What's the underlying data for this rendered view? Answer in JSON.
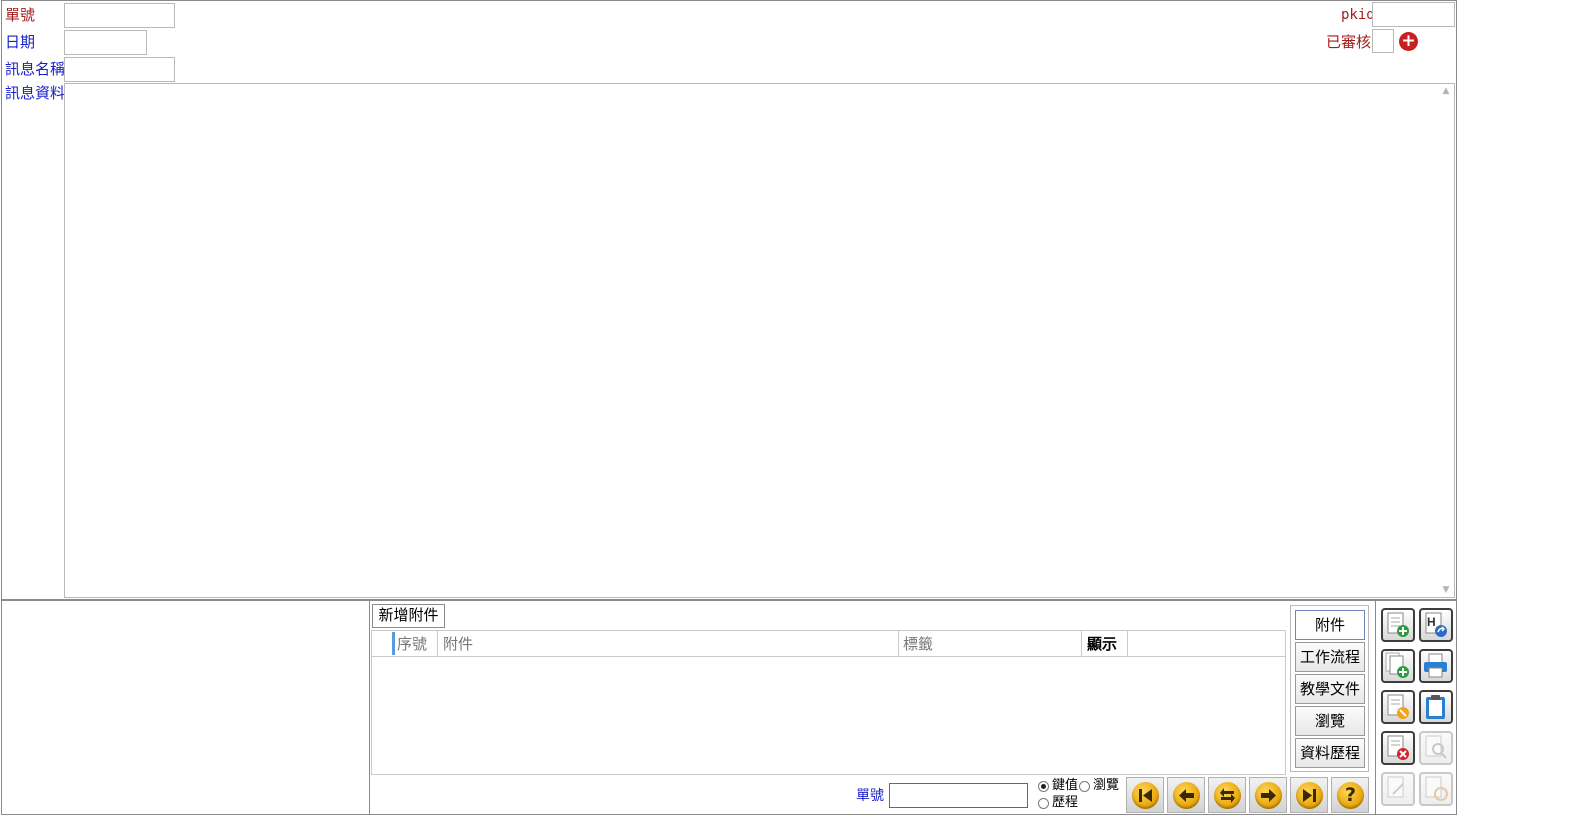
{
  "form": {
    "order_no_label": "單號",
    "date_label": "日期",
    "msg_name_label": "訊息名稱",
    "msg_data_label": "訊息資料",
    "pkid_label": "pkid",
    "reviewed_label": "已審核",
    "order_no_value": "",
    "date_value": "",
    "msg_name_value": "",
    "msg_data_value": "",
    "pkid_value": ""
  },
  "attachments": {
    "add_button": "新增附件",
    "columns": [
      "序號",
      "附件",
      "標籤",
      "顯示"
    ],
    "rows": []
  },
  "side_tabs": [
    "附件",
    "工作流程",
    "教學文件",
    "瀏覽",
    "資料歷程"
  ],
  "footer": {
    "search_label": "單號",
    "search_value": "",
    "radio_key": "鍵值",
    "radio_browse": "瀏覽",
    "radio_history": "歷程",
    "selected_radio": "鍵值"
  },
  "nav_icons": [
    "first-record-icon",
    "previous-record-icon",
    "refresh-icon",
    "next-record-icon",
    "last-record-icon",
    "help-icon"
  ],
  "toolbar_icons": [
    "add-record-icon",
    "html-export-icon",
    "copy-record-icon",
    "print-icon",
    "edit-record-icon",
    "clipboard-icon",
    "delete-record-icon",
    "search-disabled-icon",
    "save-disabled-icon",
    "cancel-disabled-icon"
  ],
  "colors": {
    "label_red": "#a51d1d",
    "label_blue": "#1a21c8",
    "add_circle": "#c62020",
    "nav_gold": "#e9a80d"
  }
}
